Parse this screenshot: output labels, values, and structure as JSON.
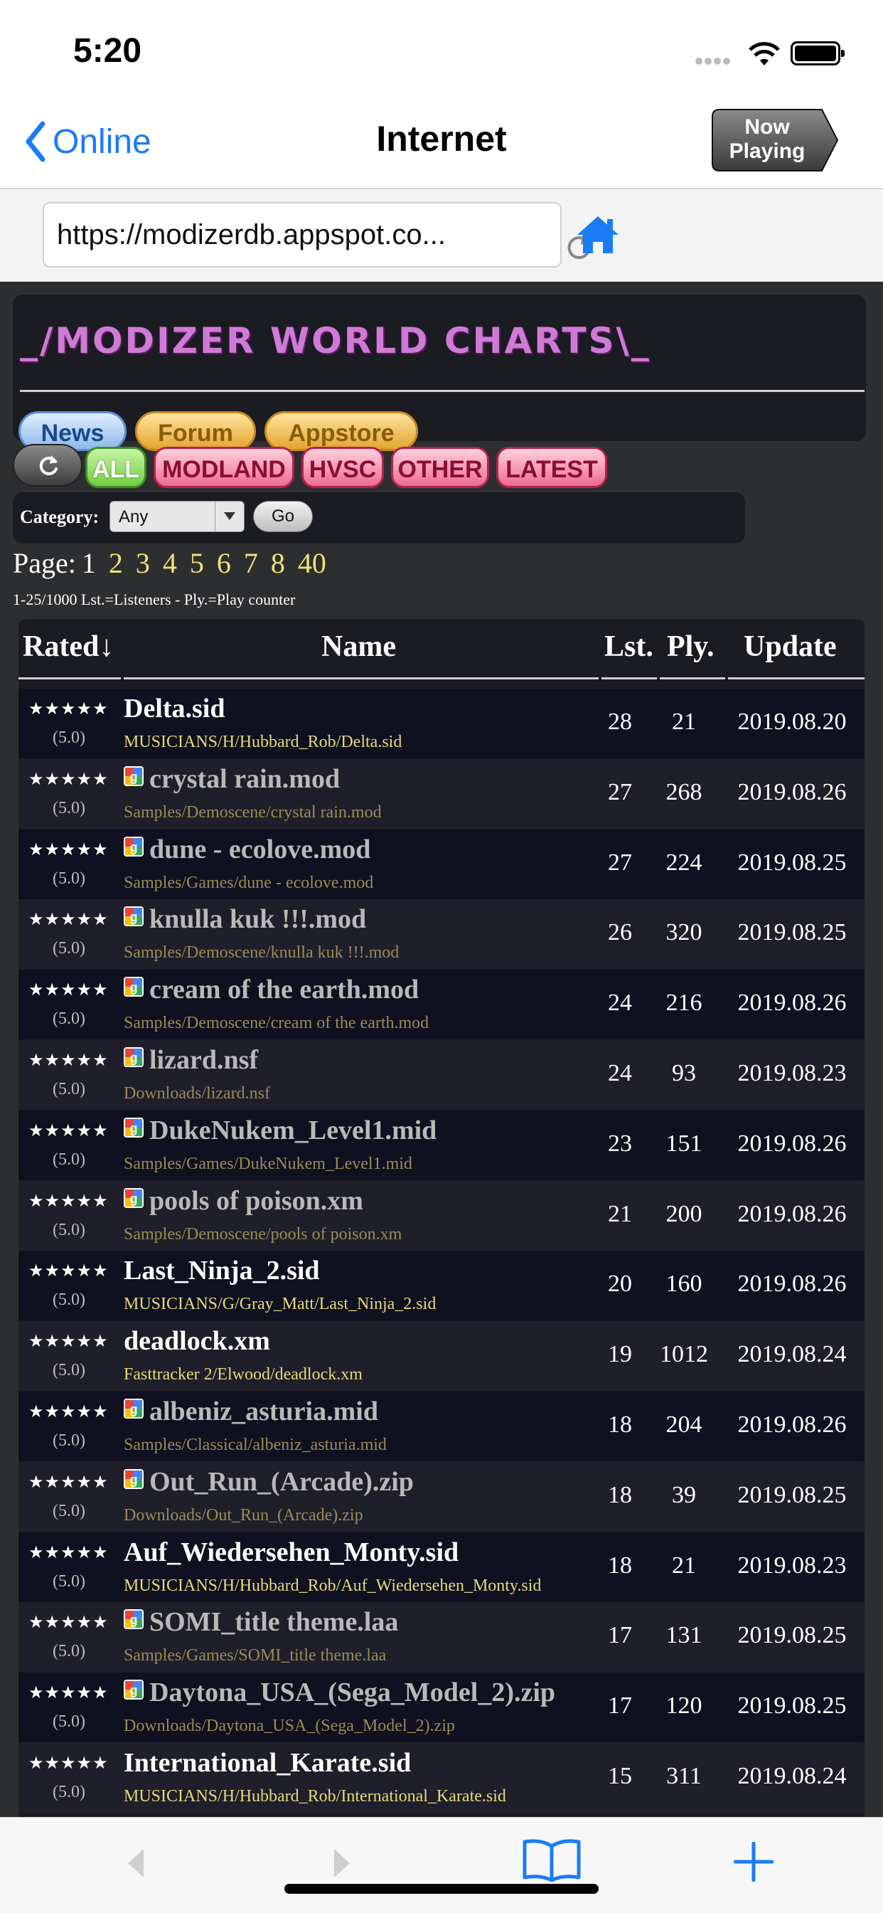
{
  "status": {
    "time": "5:20"
  },
  "nav": {
    "back_label": "Online",
    "title": "Internet",
    "now_playing_line1": "Now",
    "now_playing_line2": "Playing"
  },
  "browser": {
    "url": "https://modizerdb.appspot.co..."
  },
  "site": {
    "logo_text": "_/MODIZER WORLD CHARTS\\_",
    "top_buttons": [
      "News",
      "Forum",
      "Appstore"
    ],
    "tabs": [
      "ALL",
      "MODLAND",
      "HVSC",
      "OTHER",
      "LATEST"
    ],
    "category_label": "Category:",
    "category_value": "Any",
    "go_label": "Go",
    "page_label": "Page:",
    "current_page": "1",
    "pages": [
      "2",
      "3",
      "4",
      "5",
      "6",
      "7",
      "8",
      "40"
    ],
    "legend": "1-25/1000  Lst.=Listeners - Ply.=Play counter"
  },
  "table": {
    "headers": {
      "rated": "Rated↓",
      "name": "Name",
      "lst": "Lst.",
      "ply": "Ply.",
      "update": "Update"
    },
    "rows": [
      {
        "stars": "★★★★★",
        "score": "(5.0)",
        "name": "Delta.sid",
        "path": "MUSICIANS/H/Hubbard_Rob/Delta.sid",
        "lst": "28",
        "ply": "21",
        "update": "2019.08.20",
        "sid": true
      },
      {
        "stars": "★★★★★",
        "score": "(5.0)",
        "name": "crystal rain.mod",
        "path": "Samples/Demoscene/crystal rain.mod",
        "lst": "27",
        "ply": "268",
        "update": "2019.08.26",
        "sid": false
      },
      {
        "stars": "★★★★★",
        "score": "(5.0)",
        "name": "dune - ecolove.mod",
        "path": "Samples/Games/dune - ecolove.mod",
        "lst": "27",
        "ply": "224",
        "update": "2019.08.25",
        "sid": false
      },
      {
        "stars": "★★★★★",
        "score": "(5.0)",
        "name": "knulla kuk !!!.mod",
        "path": "Samples/Demoscene/knulla kuk !!!.mod",
        "lst": "26",
        "ply": "320",
        "update": "2019.08.25",
        "sid": false
      },
      {
        "stars": "★★★★★",
        "score": "(5.0)",
        "name": "cream of the earth.mod",
        "path": "Samples/Demoscene/cream of the earth.mod",
        "lst": "24",
        "ply": "216",
        "update": "2019.08.26",
        "sid": false
      },
      {
        "stars": "★★★★★",
        "score": "(5.0)",
        "name": "lizard.nsf",
        "path": "Downloads/lizard.nsf",
        "lst": "24",
        "ply": "93",
        "update": "2019.08.23",
        "sid": false
      },
      {
        "stars": "★★★★★",
        "score": "(5.0)",
        "name": "DukeNukem_Level1.mid",
        "path": "Samples/Games/DukeNukem_Level1.mid",
        "lst": "23",
        "ply": "151",
        "update": "2019.08.26",
        "sid": false
      },
      {
        "stars": "★★★★★",
        "score": "(5.0)",
        "name": "pools of poison.xm",
        "path": "Samples/Demoscene/pools of poison.xm",
        "lst": "21",
        "ply": "200",
        "update": "2019.08.26",
        "sid": false
      },
      {
        "stars": "★★★★★",
        "score": "(5.0)",
        "name": "Last_Ninja_2.sid",
        "path": "MUSICIANS/G/Gray_Matt/Last_Ninja_2.sid",
        "lst": "20",
        "ply": "160",
        "update": "2019.08.26",
        "sid": true
      },
      {
        "stars": "★★★★★",
        "score": "(5.0)",
        "name": "deadlock.xm",
        "path": "Fasttracker 2/Elwood/deadlock.xm",
        "lst": "19",
        "ply": "1012",
        "update": "2019.08.24",
        "sid": true
      },
      {
        "stars": "★★★★★",
        "score": "(5.0)",
        "name": "albeniz_asturia.mid",
        "path": "Samples/Classical/albeniz_asturia.mid",
        "lst": "18",
        "ply": "204",
        "update": "2019.08.26",
        "sid": false
      },
      {
        "stars": "★★★★★",
        "score": "(5.0)",
        "name": "Out_Run_(Arcade).zip",
        "path": "Downloads/Out_Run_(Arcade).zip",
        "lst": "18",
        "ply": "39",
        "update": "2019.08.25",
        "sid": false
      },
      {
        "stars": "★★★★★",
        "score": "(5.0)",
        "name": "Auf_Wiedersehen_Monty.sid",
        "path": "MUSICIANS/H/Hubbard_Rob/Auf_Wiedersehen_Monty.sid",
        "lst": "18",
        "ply": "21",
        "update": "2019.08.23",
        "sid": true
      },
      {
        "stars": "★★★★★",
        "score": "(5.0)",
        "name": "SOMI_title theme.laa",
        "path": "Samples/Games/SOMI_title theme.laa",
        "lst": "17",
        "ply": "131",
        "update": "2019.08.25",
        "sid": false
      },
      {
        "stars": "★★★★★",
        "score": "(5.0)",
        "name": "Daytona_USA_(Sega_Model_2).zip",
        "path": "Downloads/Daytona_USA_(Sega_Model_2).zip",
        "lst": "17",
        "ply": "120",
        "update": "2019.08.25",
        "sid": false
      },
      {
        "stars": "★★★★★",
        "score": "(5.0)",
        "name": "International_Karate.sid",
        "path": "MUSICIANS/H/Hubbard_Rob/International_Karate.sid",
        "lst": "15",
        "ply": "311",
        "update": "2019.08.24",
        "sid": true
      }
    ]
  },
  "toolbar": {
    "icons": [
      "back-arrow-icon",
      "forward-arrow-icon",
      "bookmarks-icon",
      "add-icon"
    ]
  },
  "colors": {
    "accent": "#1a7cf5",
    "page_bg": "#2d2e30",
    "row_odd": "#0f1020",
    "row_even": "#1e1f2a",
    "page_link": "#f0e27a"
  }
}
